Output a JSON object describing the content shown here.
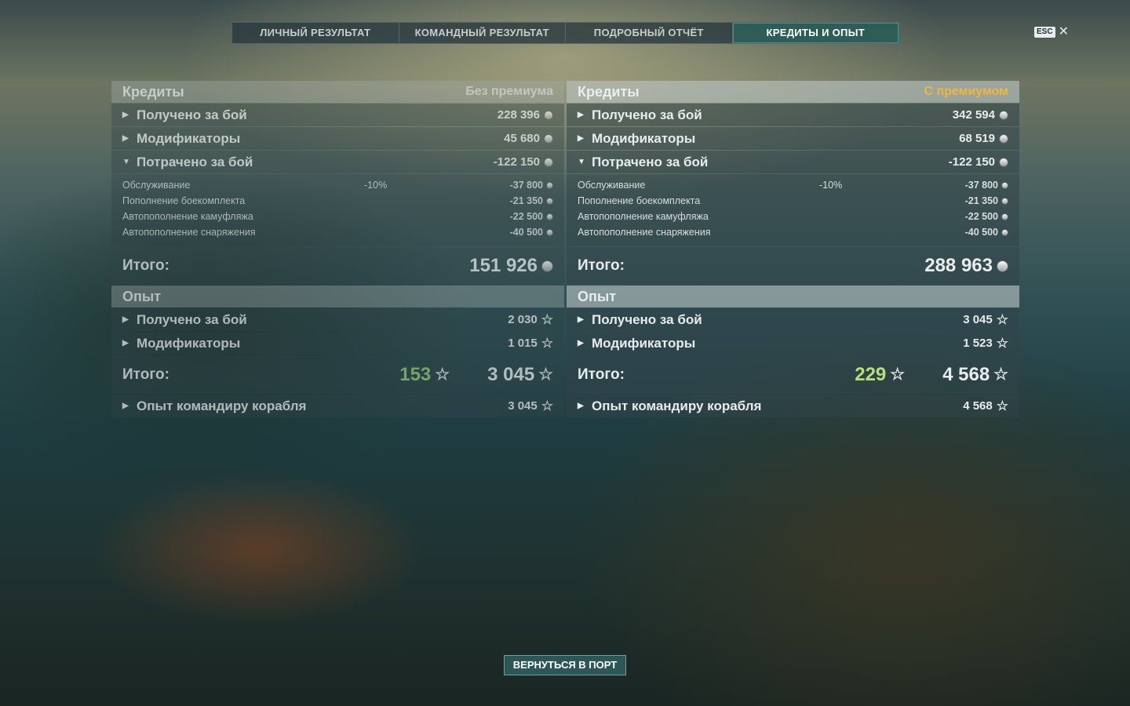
{
  "tabs": [
    {
      "label": "ЛИЧНЫЙ РЕЗУЛЬТАТ"
    },
    {
      "label": "КОМАНДНЫЙ РЕЗУЛЬТАТ"
    },
    {
      "label": "ПОДРОБНЫЙ ОТЧЁТ"
    },
    {
      "label": "КРЕДИТЫ И ОПЫТ"
    }
  ],
  "active_tab": "КРЕДИТЫ И ОПЫТ",
  "esc_label": "ESC",
  "close_glyph": "✕",
  "left": {
    "credits_title": "Кредиты",
    "credits_subtitle": "Без премиума",
    "earned_label": "Получено за бой",
    "earned_value": "228 396",
    "mods_label": "Модификаторы",
    "mods_value": "45 680",
    "spent_label": "Потрачено за бой",
    "spent_value": "-122 150",
    "details": [
      {
        "name": "Обслуживание",
        "pct": "-10%",
        "value": "-37 800"
      },
      {
        "name": "Пополнение боекомплекта",
        "pct": "",
        "value": "-21 350"
      },
      {
        "name": "Автопополнение камуфляжа",
        "pct": "",
        "value": "-22 500"
      },
      {
        "name": "Автопополнение снаряжения",
        "pct": "",
        "value": "-40 500"
      }
    ],
    "total_label": "Итого:",
    "credits_total": "151 926",
    "exp_title": "Опыт",
    "exp_earned_label": "Получено за бой",
    "exp_earned_value": "2 030",
    "exp_mods_label": "Модификаторы",
    "exp_mods_value": "1 015",
    "exp_total_label": "Итого:",
    "exp_free": "153",
    "exp_total": "3 045",
    "commander_label": "Опыт командиру корабля",
    "commander_value": "3 045"
  },
  "right": {
    "credits_title": "Кредиты",
    "credits_subtitle": "С премиумом",
    "earned_label": "Получено за бой",
    "earned_value": "342 594",
    "mods_label": "Модификаторы",
    "mods_value": "68 519",
    "spent_label": "Потрачено за бой",
    "spent_value": "-122 150",
    "details": [
      {
        "name": "Обслуживание",
        "pct": "-10%",
        "value": "-37 800"
      },
      {
        "name": "Пополнение боекомплекта",
        "pct": "",
        "value": "-21 350"
      },
      {
        "name": "Автопополнение камуфляжа",
        "pct": "",
        "value": "-22 500"
      },
      {
        "name": "Автопополнение снаряжения",
        "pct": "",
        "value": "-40 500"
      }
    ],
    "total_label": "Итого:",
    "credits_total": "288 963",
    "exp_title": "Опыт",
    "exp_earned_label": "Получено за бой",
    "exp_earned_value": "3 045",
    "exp_mods_label": "Модификаторы",
    "exp_mods_value": "1 523",
    "exp_total_label": "Итого:",
    "exp_free": "229",
    "exp_total": "4 568",
    "commander_label": "Опыт командиру корабля",
    "commander_value": "4 568"
  },
  "back_button": "ВЕРНУТЬСЯ В ПОРТ",
  "icons": {
    "expand": "arrow-right-icon",
    "collapse": "arrow-down-icon",
    "credits": "credits-coin-icon",
    "experience": "star-icon"
  },
  "colors": {
    "premium_gold": "#f2b63a",
    "free_exp_green": "#b3e07a",
    "active_tab": "#2d5f5a"
  }
}
